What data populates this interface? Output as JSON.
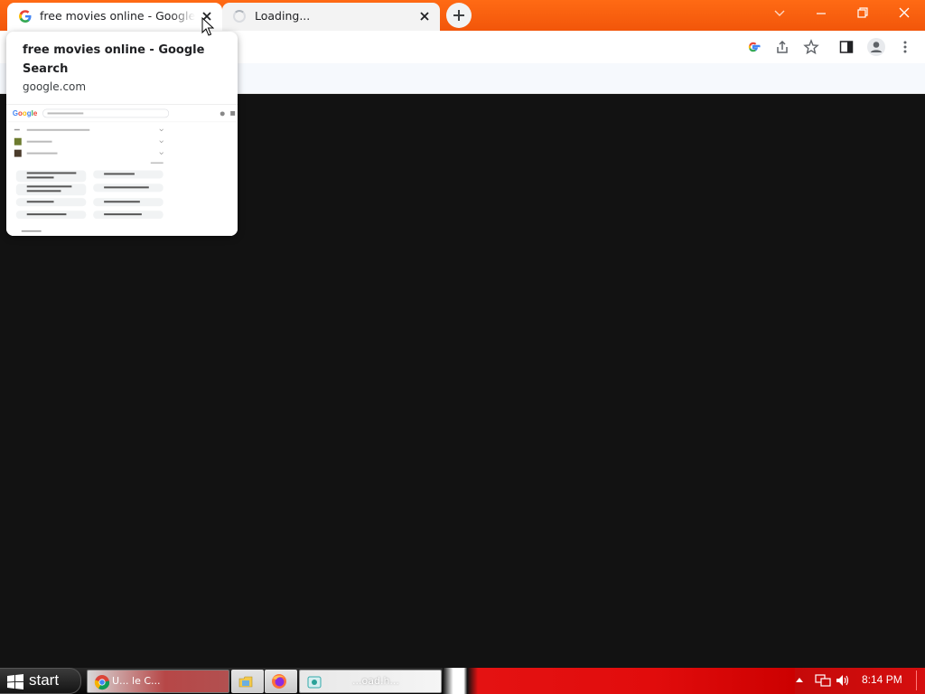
{
  "tabs": [
    {
      "title": "free movies online - Google Search",
      "favicon": "google-g-icon",
      "active": true
    },
    {
      "title": "Loading...",
      "favicon": "loading-spinner-icon",
      "active": false
    }
  ],
  "hover_card": {
    "title": "free movies online - Google Search",
    "domain": "google.com"
  },
  "toolbar_icons": [
    "google-lens-icon",
    "share-icon",
    "bookmark-star-icon",
    "side-panel-icon",
    "profile-icon",
    "menu-kebab-icon"
  ],
  "window_buttons": [
    "tab-search",
    "minimize",
    "restore",
    "close"
  ],
  "colors": {
    "tabstrip": "#f2560a",
    "taskbar_red": "#d50f0f",
    "content_bg": "#121212"
  },
  "taskbar": {
    "start_label": "start",
    "tasks": [
      {
        "label": "U...              le C...",
        "icon": "chrome-icon"
      },
      {
        "label": "",
        "icon": "file-explorer-icon"
      },
      {
        "label": "",
        "icon": "firefox-icon"
      },
      {
        "label": "...oad.h...",
        "icon": "photo-viewer-icon"
      }
    ],
    "clock": "8:14 PM"
  }
}
